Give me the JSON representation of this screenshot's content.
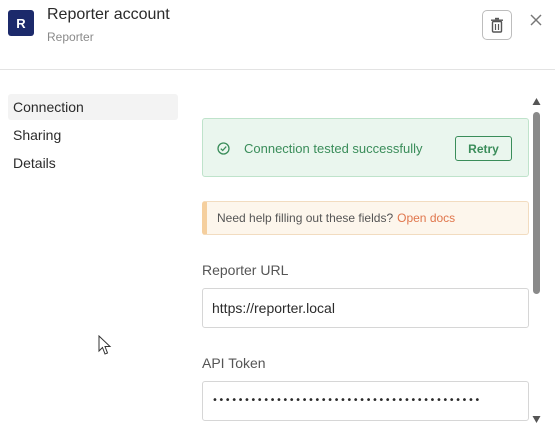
{
  "header": {
    "logo_letter": "R",
    "title": "Reporter account",
    "subtitle": "Reporter",
    "delete_icon": "trash-icon",
    "close_icon": "close-icon"
  },
  "nav": {
    "items": [
      {
        "label": "Connection",
        "active": true
      },
      {
        "label": "Sharing",
        "active": false
      },
      {
        "label": "Details",
        "active": false
      }
    ]
  },
  "connection": {
    "status_message": "Connection tested successfully",
    "retry_label": "Retry",
    "help_text": "Need help filling out these fields?",
    "help_link": "Open docs",
    "url_label": "Reporter URL",
    "url_value": "https://reporter.local",
    "token_label": "API Token",
    "token_value": "••••••••••••••••••••••••••••••••••••••••••"
  },
  "colors": {
    "brand": "#1c2a6b",
    "success": "#3a8d5a",
    "link": "#e0764c"
  }
}
